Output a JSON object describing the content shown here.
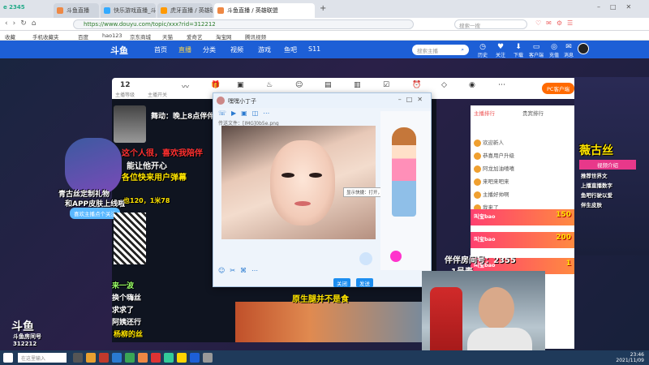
{
  "browser": {
    "tabs": [
      {
        "label": "斗鱼直播",
        "icon_color": "#e84"
      },
      {
        "label": "快乐游戏直播_斗鱼直播",
        "icon_color": "#3af"
      },
      {
        "label": "虎牙直播 / 英雄联盟",
        "icon_color": "#f90"
      },
      {
        "label": "斗鱼直播 / 英雄联盟",
        "icon_color": "#e84"
      }
    ],
    "url": "https://www.douyu.com/topic/xxx?rid=312212",
    "search_placeholder": "搜索一搜",
    "bookmarks": [
      "收藏",
      "手机收藏夹",
      "百度",
      "hao123",
      "京东商城",
      "天猫",
      "爱奇艺",
      "淘宝网",
      "腾讯视频"
    ]
  },
  "site": {
    "logo": "斗鱼",
    "nav": [
      "首页",
      "直播",
      "分类",
      "视频",
      "游戏",
      "鱼吧",
      "S11"
    ],
    "search_placeholder": "搜索主播",
    "header_icons": [
      "历史",
      "关注",
      "下载",
      "客户端",
      "充值",
      "消息",
      "个人中心"
    ]
  },
  "room": {
    "level": "12",
    "level_label": "主播等级",
    "toolbar": [
      "主播开关",
      "签到",
      "礼物",
      "宝箱",
      "粉丝",
      "热度",
      "弹幕",
      "分享",
      "设置",
      "录像",
      "活动",
      "更多"
    ],
    "pc_button": "PC客户端"
  },
  "overlays": {
    "banner_title": "舞动：晚上8点伴伴小姐",
    "text1": "这个人很，喜欢我陪伴",
    "text2": "能让他开心",
    "text3": "各位快来用户弹幕",
    "join_text": "喜欢主播点个关注",
    "gift_text1": "青古丝定制礼物",
    "gift_text2": "和APP皮肤上线啦",
    "gift_text3": "也120，1米78",
    "line_a": "来一波",
    "line_b": "换个嗨丝",
    "line_c": "求求了",
    "line_d": "阿姨还行",
    "line_e": "杨柳的丝",
    "room_num_label": "斗鱼房间号",
    "room_num": "312212",
    "partner_label": "伴伴房间号：2355",
    "partner_sub": "1号麦",
    "red_line": "原生腿并不是食",
    "sign_name": "薇古丝",
    "sign_items": [
      "视频介绍",
      "推荐世界文",
      "上播直播数字",
      "鱼吧行驶以爱",
      "伴生皮肤"
    ]
  },
  "qq": {
    "title": "嘿嘿小丁子",
    "file_label": "传送文件：[IMG]0b5e.png",
    "tooltip": "显示快捷：打开，双击查看原图",
    "btn_close": "关闭",
    "btn_send": "发送"
  },
  "chat": {
    "tabs": [
      "主播排行",
      "贵宾排行"
    ],
    "rows": [
      "欢迎新人",
      "恭喜用户升级",
      "阿龙加油嘻嘻",
      "来吧来吧来",
      "主播好帅啊",
      "我来了"
    ],
    "gifts": [
      {
        "user": "叫宝bao",
        "count": "150"
      },
      {
        "user": "叫宝bao",
        "count": "200"
      },
      {
        "user": "叫宝bao",
        "count": "1"
      }
    ]
  },
  "taskbar": {
    "time": "23:46",
    "date": "2021/11/09",
    "search": "在这里输入"
  }
}
